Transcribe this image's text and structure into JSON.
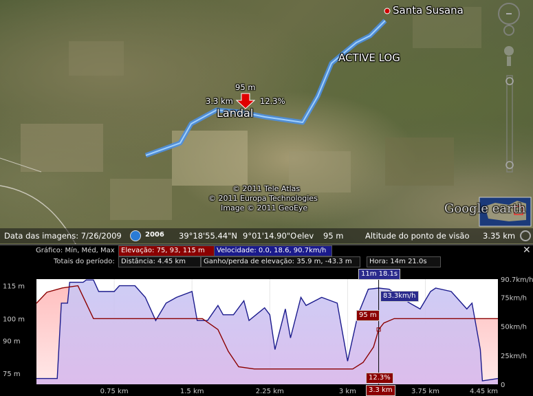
{
  "map": {
    "places": {
      "santa_susana": "Santa Susana",
      "active_log": "ACTIVE LOG",
      "landal": "Landal"
    },
    "marker": {
      "elevation_label": "95 m",
      "distance_label": "3.3 km",
      "grade_label": "12.3%"
    },
    "copyright": [
      "© 2011 Tele Atlas",
      "© 2011 Europa Technologies",
      "Image © 2011 GeoEye"
    ],
    "logo": "Google earth"
  },
  "status_bar": {
    "imagery_date": "Data das imagens: 7/26/2009",
    "year": "2006",
    "lat": "39°18'55.44\"N",
    "lon": "9°01'14.90\"O",
    "elev_label": "elev",
    "elev_value": "95 m",
    "eye_alt_label": "Altitude do ponto de visão",
    "eye_alt_value": "3.35 km"
  },
  "profile": {
    "close_icon": "close-icon",
    "graph_label": "Gráfico: Mín, Méd, Max",
    "elevation_field": "Elevação: 75, 93, 115 m",
    "speed_field": "Velocidade: 0.0, 18.6, 90.7km/h",
    "totals_label": "Totais do período:",
    "distance_field": "Distância: 4.45 km",
    "gain_field": "Ganho/perda de elevação: 35.9 m, -43.3 m",
    "time_field": "Hora: 14m 21.0s",
    "cursor": {
      "time": "11m 18.1s",
      "speed": "83.3km/h",
      "elevation": "95 m",
      "grade": "12.3%",
      "distance": "3.3 km"
    },
    "colors": {
      "elevation": "#8b0000",
      "speed": "#1a1a8c"
    }
  },
  "chart_data": {
    "type": "line",
    "x_unit": "km",
    "xlim": [
      0,
      4.45
    ],
    "x_ticks": [
      "0.75 km",
      "1.5 km",
      "2.25 km",
      "3 km",
      "3.75 km",
      "4.45 km"
    ],
    "y_left_ticks": [
      "115 m",
      "100 m",
      "90 m",
      "75 m"
    ],
    "y_right_ticks": [
      "90.7km/h",
      "75km/h",
      "50km/h",
      "25km/h",
      "0"
    ],
    "series": [
      {
        "name": "Elevação",
        "unit": "m",
        "ylim": [
          70,
          118
        ],
        "x": [
          0,
          0.1,
          0.25,
          0.4,
          0.55,
          0.7,
          0.9,
          1.2,
          1.6,
          1.75,
          1.85,
          1.95,
          2.1,
          2.5,
          2.9,
          3.05,
          3.15,
          3.25,
          3.3,
          3.35,
          3.45,
          3.6,
          4.0,
          4.45
        ],
        "values": [
          107,
          112,
          114,
          115,
          100,
          100,
          100,
          100,
          100,
          95,
          85,
          78,
          77,
          77,
          77,
          77,
          80,
          87,
          95,
          98,
          100,
          100,
          100,
          100
        ]
      },
      {
        "name": "Velocidade",
        "unit": "km/h",
        "ylim": [
          0,
          90.7
        ],
        "x": [
          0,
          0.2,
          0.24,
          0.3,
          0.32,
          0.45,
          0.48,
          0.55,
          0.6,
          0.75,
          0.8,
          0.95,
          1.05,
          1.15,
          1.25,
          1.35,
          1.5,
          1.55,
          1.65,
          1.75,
          1.8,
          1.9,
          2.0,
          2.05,
          2.2,
          2.25,
          2.3,
          2.4,
          2.45,
          2.55,
          2.6,
          2.75,
          2.9,
          3.0,
          3.1,
          3.2,
          3.3,
          3.4,
          3.6,
          3.7,
          3.8,
          3.85,
          4.0,
          4.15,
          4.2,
          4.28,
          4.3,
          4.45
        ],
        "values": [
          5,
          5,
          70,
          70,
          88,
          88,
          90,
          90,
          80,
          80,
          85,
          85,
          75,
          55,
          70,
          75,
          80,
          55,
          55,
          68,
          60,
          60,
          72,
          55,
          66,
          60,
          30,
          65,
          40,
          75,
          68,
          75,
          70,
          20,
          60,
          82,
          83,
          82,
          70,
          65,
          80,
          83,
          80,
          65,
          70,
          30,
          3,
          5
        ]
      }
    ]
  }
}
